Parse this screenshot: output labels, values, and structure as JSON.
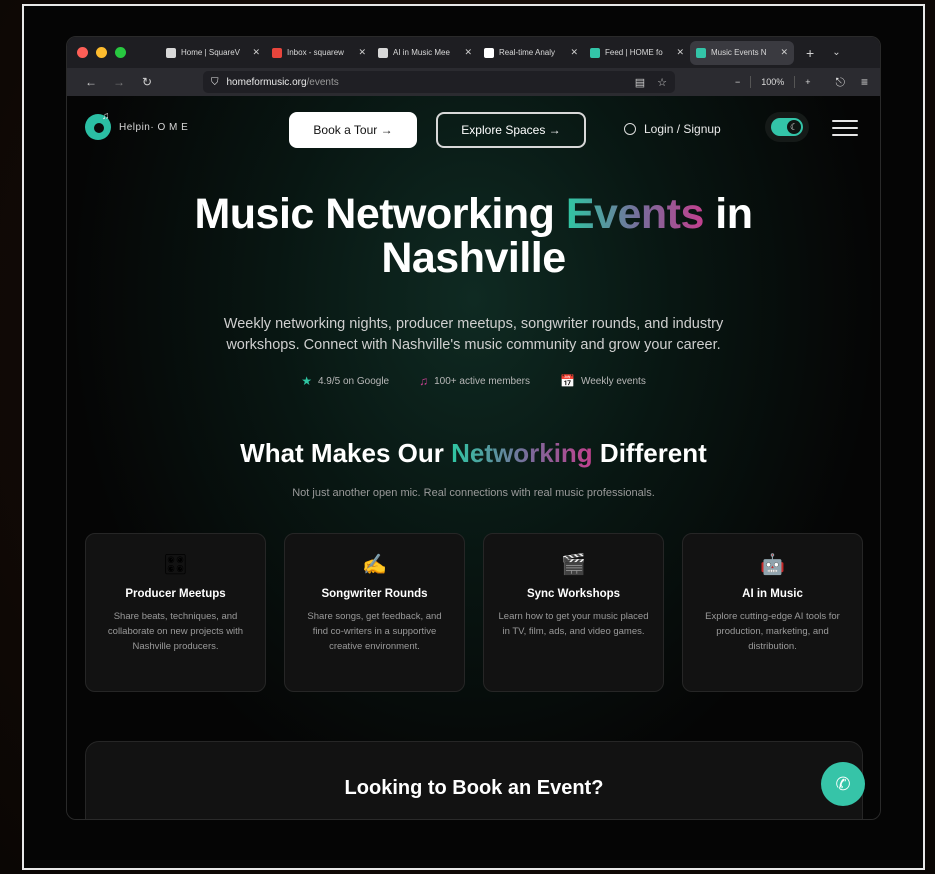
{
  "browser": {
    "tabs": [
      {
        "label": "Home | SquareV",
        "icon": "squarespace-icon",
        "color": "#d8d8d8"
      },
      {
        "label": "Inbox - squarew",
        "icon": "gmail-icon",
        "color": "#e8453c"
      },
      {
        "label": "AI in Music Mee",
        "icon": "p-icon",
        "color": "#d8d8d8"
      },
      {
        "label": "Real-time Analy",
        "icon": "wix-icon",
        "color": "#ffffff"
      },
      {
        "label": "Feed | HOME fo",
        "icon": "home-logo-icon",
        "color": "#33c4a8"
      },
      {
        "label": "Music Events N",
        "icon": "home-logo-icon",
        "color": "#33c4a8",
        "active": true
      }
    ],
    "url_host": "homeformusic.org",
    "url_path": "/events",
    "zoom": "100%",
    "zoom_minus": "−",
    "zoom_plus": "+"
  },
  "site": {
    "logo_text": "Helpin· O M E",
    "book_tour": "Book a Tour →",
    "explore_spaces": "Explore Spaces →",
    "login": "Login / Signup"
  },
  "hero": {
    "title_part1": "Music Networking ",
    "title_highlight": "Events",
    "title_part2": " in",
    "title_line2": "Nashville",
    "subtitle": "Weekly networking nights, producer meetups, songwriter rounds, and industry workshops. Connect with Nashville's music community and grow your career.",
    "stats": [
      {
        "icon": "star-icon",
        "glyph": "★",
        "color": "#2fc7a3",
        "label": "4.9/5 on Google"
      },
      {
        "icon": "music-note-icon",
        "glyph": "♫",
        "color": "#c2408e",
        "label": "100+ active members"
      },
      {
        "icon": "calendar-icon",
        "glyph": "📅",
        "color": "#d0d0d0",
        "label": "Weekly events"
      }
    ]
  },
  "features": {
    "title_part1": "What Makes Our ",
    "title_highlight": "Networking",
    "title_part2": " Different",
    "subtitle": "Not just another open mic. Real connections with real music professionals.",
    "cards": [
      {
        "icon": "mixer-icon",
        "glyph": "🎛",
        "title": "Producer Meetups",
        "desc": "Share beats, techniques, and collaborate on new projects with Nashville producers."
      },
      {
        "icon": "writing-hand-icon",
        "glyph": "✍",
        "title": "Songwriter Rounds",
        "desc": "Share songs, get feedback, and find co-writers in a supportive creative environment."
      },
      {
        "icon": "clapperboard-icon",
        "glyph": "🎬",
        "title": "Sync Workshops",
        "desc": "Learn how to get your music placed in TV, film, ads, and video games."
      },
      {
        "icon": "robot-icon",
        "glyph": "🤖",
        "title": "AI in Music",
        "desc": "Explore cutting-edge AI tools for production, marketing, and distribution."
      }
    ]
  },
  "booking": {
    "title": "Looking to Book an Event?"
  }
}
